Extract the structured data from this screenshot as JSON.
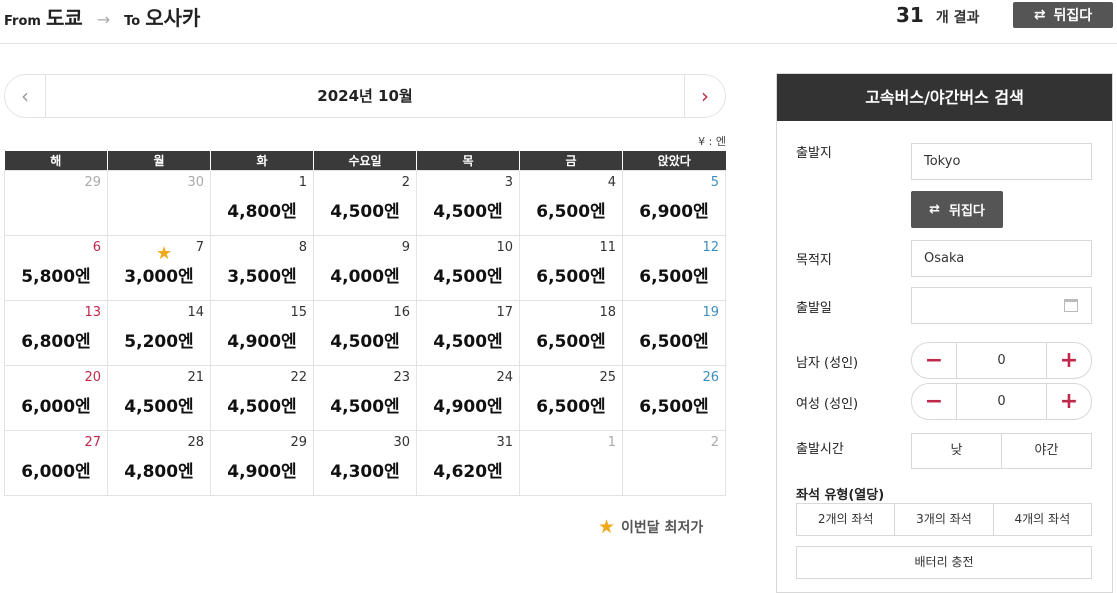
{
  "header": {
    "from_label": "From",
    "from_city": "도쿄",
    "arrow": "→",
    "to_label": "To",
    "to_city": "오사카",
    "result_count": "31",
    "result_unit": "개 결과",
    "swap_label": "뒤집다"
  },
  "calendar": {
    "month_title": "2024년 10월",
    "prev": "‹",
    "next": "›",
    "currency_note": "¥ : 엔",
    "weekdays": [
      "해",
      "월",
      "화",
      "수요일",
      "목",
      "금",
      "앉았다"
    ],
    "weeks": [
      [
        {
          "day": "29",
          "price": "",
          "kind": "other"
        },
        {
          "day": "30",
          "price": "",
          "kind": "other"
        },
        {
          "day": "1",
          "price": "4,800엔",
          "kind": ""
        },
        {
          "day": "2",
          "price": "4,500엔",
          "kind": ""
        },
        {
          "day": "3",
          "price": "4,500엔",
          "kind": ""
        },
        {
          "day": "4",
          "price": "6,500엔",
          "kind": ""
        },
        {
          "day": "5",
          "price": "6,900엔",
          "kind": "sat"
        }
      ],
      [
        {
          "day": "6",
          "price": "5,800엔",
          "kind": "sun"
        },
        {
          "day": "7",
          "price": "3,000엔",
          "kind": "",
          "lowest": true
        },
        {
          "day": "8",
          "price": "3,500엔",
          "kind": ""
        },
        {
          "day": "9",
          "price": "4,000엔",
          "kind": ""
        },
        {
          "day": "10",
          "price": "4,500엔",
          "kind": ""
        },
        {
          "day": "11",
          "price": "6,500엔",
          "kind": ""
        },
        {
          "day": "12",
          "price": "6,500엔",
          "kind": "sat"
        }
      ],
      [
        {
          "day": "13",
          "price": "6,800엔",
          "kind": "sun"
        },
        {
          "day": "14",
          "price": "5,200엔",
          "kind": ""
        },
        {
          "day": "15",
          "price": "4,900엔",
          "kind": ""
        },
        {
          "day": "16",
          "price": "4,500엔",
          "kind": ""
        },
        {
          "day": "17",
          "price": "4,500엔",
          "kind": ""
        },
        {
          "day": "18",
          "price": "6,500엔",
          "kind": ""
        },
        {
          "day": "19",
          "price": "6,500엔",
          "kind": "sat"
        }
      ],
      [
        {
          "day": "20",
          "price": "6,000엔",
          "kind": "sun"
        },
        {
          "day": "21",
          "price": "4,500엔",
          "kind": ""
        },
        {
          "day": "22",
          "price": "4,500엔",
          "kind": ""
        },
        {
          "day": "23",
          "price": "4,500엔",
          "kind": ""
        },
        {
          "day": "24",
          "price": "4,900엔",
          "kind": ""
        },
        {
          "day": "25",
          "price": "6,500엔",
          "kind": ""
        },
        {
          "day": "26",
          "price": "6,500엔",
          "kind": "sat"
        }
      ],
      [
        {
          "day": "27",
          "price": "6,000엔",
          "kind": "sun"
        },
        {
          "day": "28",
          "price": "4,800엔",
          "kind": ""
        },
        {
          "day": "29",
          "price": "4,900엔",
          "kind": ""
        },
        {
          "day": "30",
          "price": "4,300엔",
          "kind": ""
        },
        {
          "day": "31",
          "price": "4,620엔",
          "kind": ""
        },
        {
          "day": "1",
          "price": "",
          "kind": "other"
        },
        {
          "day": "2",
          "price": "",
          "kind": "other"
        }
      ]
    ],
    "legend_label": "이번달 최저가"
  },
  "search": {
    "title": "고속버스/야간버스 검색",
    "origin_label": "출발지",
    "origin_value": "Tokyo",
    "swap_label": "뒤집다",
    "destination_label": "목적지",
    "destination_value": "Osaka",
    "date_label": "출발일",
    "male_label": "남자 (성인)",
    "male_count": "0",
    "female_label": "여성 (성인)",
    "female_count": "0",
    "time_label": "출발시간",
    "time_options": [
      "낮",
      "야간"
    ],
    "seat_label": "좌석 유형(열당)",
    "seat_options": [
      "2개의 좌석",
      "3개의 좌석",
      "4개의 좌석"
    ],
    "battery_label": "배터리 충전"
  },
  "colors": {
    "accent": "#c0284a",
    "saturday": "#3d8ec0",
    "star": "#f0a81c",
    "dark": "#333333"
  }
}
